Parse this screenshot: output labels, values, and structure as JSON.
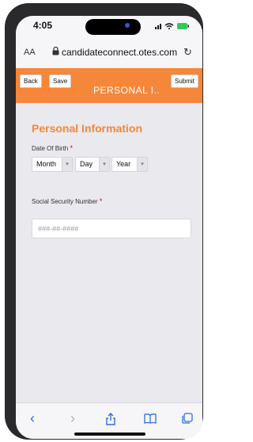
{
  "status": {
    "time": "4:05",
    "signal": "••ll ≋ ▭"
  },
  "browser": {
    "aa": "AA",
    "url": "candidateconnect.otes.com",
    "reload_icon": "↻"
  },
  "header": {
    "back_label": "Back",
    "save_label": "Save",
    "submit_label": "Submit",
    "title": "PERSONAL I..",
    "accent": "#f5863a"
  },
  "form": {
    "section_title": "Personal Information",
    "dob_label": "Date Of Birth",
    "dob_required": "*",
    "month": "Month",
    "day": "Day",
    "year": "Year",
    "ssn_label": "Social Security Number",
    "ssn_required": "*",
    "ssn_placeholder": "###-##-####"
  },
  "toolbar": {
    "back_icon": "‹",
    "forward_icon": "›",
    "share_icon": "⇧",
    "bookmarks_icon": "📖",
    "tabs_icon": "⧉"
  }
}
